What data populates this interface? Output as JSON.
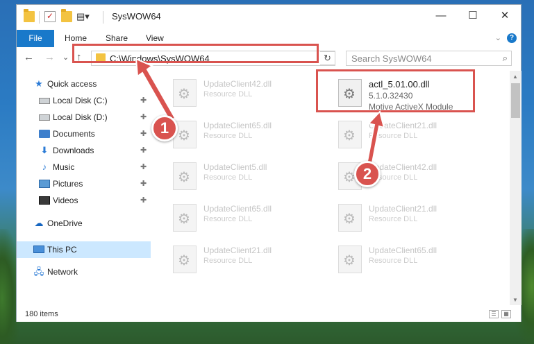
{
  "title": "SysWOW64",
  "window_controls": {
    "minimize": "—",
    "maximize": "☐",
    "close": "✕"
  },
  "ribbon": {
    "tabs": [
      "File",
      "Home",
      "Share",
      "View"
    ],
    "help": "?"
  },
  "nav": {
    "back": "←",
    "forward": "→",
    "recent": "⌄",
    "up": "↑",
    "address": "C:\\Windows\\SysWOW64",
    "refresh": "↻",
    "search_placeholder": "Search SysWOW64"
  },
  "sidebar": {
    "items": [
      {
        "label": "Quick access",
        "pinned": false
      },
      {
        "label": "Local Disk (C:)",
        "pinned": true
      },
      {
        "label": "Local Disk (D:)",
        "pinned": true
      },
      {
        "label": "Documents",
        "pinned": true
      },
      {
        "label": "Downloads",
        "pinned": true
      },
      {
        "label": "Music",
        "pinned": true
      },
      {
        "label": "Pictures",
        "pinned": true
      },
      {
        "label": "Videos",
        "pinned": true
      },
      {
        "label": "OneDrive",
        "pinned": false
      },
      {
        "label": "This PC",
        "pinned": false,
        "selected": true
      },
      {
        "label": "Network",
        "pinned": false
      }
    ],
    "pin_glyph": "📌"
  },
  "files": [
    {
      "name": "UpdateClient42.dll",
      "type": "Resource DLL"
    },
    {
      "name": "actl_5.01.00.dll",
      "version": "5.1.0.32430",
      "type": "Motive ActiveX Module",
      "highlighted": true
    },
    {
      "name": "UpdateClient65.dll",
      "type": "Resource DLL"
    },
    {
      "name": "UpdateClient21.dll",
      "type": "Resource DLL"
    },
    {
      "name": "UpdateClient5.dll",
      "type": "Resource DLL"
    },
    {
      "name": "UpdateClient42.dll",
      "type": "Resource DLL"
    },
    {
      "name": "UpdateClient65.dll",
      "type": "Resource DLL"
    },
    {
      "name": "UpdateClient21.dll",
      "type": "Resource DLL"
    },
    {
      "name": "UpdateClient21.dll",
      "type": "Resource DLL"
    },
    {
      "name": "UpdateClient65.dll",
      "type": "Resource DLL"
    }
  ],
  "status": {
    "item_count": "180 items"
  },
  "annotations": {
    "step1": "1",
    "step2": "2",
    "color": "#d9534f"
  }
}
